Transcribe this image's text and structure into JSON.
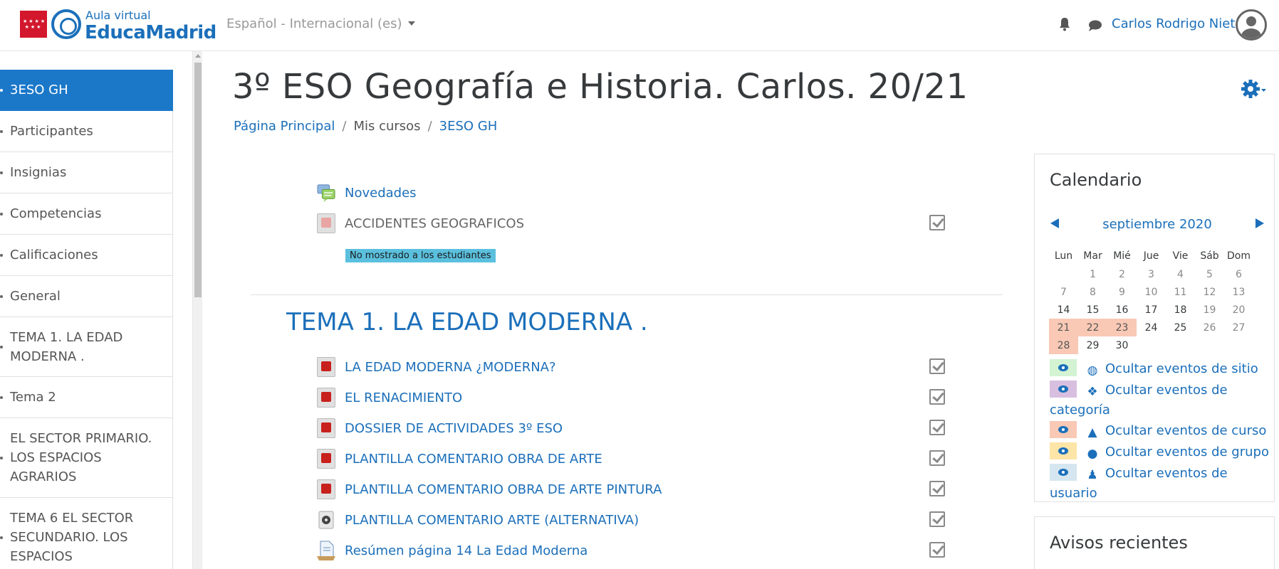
{
  "header": {
    "logo_small": "Aula virtual",
    "logo_big": "EducaMadrid",
    "language": "Español - Internacional (es)",
    "user_name": "Carlos Rodrigo Nieto"
  },
  "drawer": {
    "items": [
      {
        "label": "3ESO GH",
        "active": true
      },
      {
        "label": "Participantes"
      },
      {
        "label": "Insignias"
      },
      {
        "label": "Competencias"
      },
      {
        "label": "Calificaciones"
      },
      {
        "label": "General"
      },
      {
        "label": "TEMA 1. LA EDAD MODERNA ."
      },
      {
        "label": "Tema 2"
      },
      {
        "label": "EL SECTOR PRIMARIO. LOS ESPACIOS AGRARIOS"
      },
      {
        "label": "TEMA 6 EL SECTOR SECUNDARIO. LOS ESPACIOS"
      }
    ]
  },
  "main": {
    "title": "3º ESO Geografía e Historia. Carlos. 20/21",
    "breadcrumb": {
      "home": "Página Principal",
      "my_courses": "Mis cursos",
      "course": "3ESO GH"
    },
    "general_activities": [
      {
        "name": "Novedades",
        "icon": "forum-icon"
      },
      {
        "name": "ACCIDENTES GEOGRAFICOS",
        "icon": "pdf-icon",
        "hidden": true
      }
    ],
    "hidden_badge": "No mostrado a los estudiantes",
    "section_title": "TEMA 1. LA EDAD MODERNA .",
    "section_activities": [
      {
        "name": "LA EDAD MODERNA ¿MODERNA?",
        "icon": "pdf-icon"
      },
      {
        "name": "EL RENACIMIENTO",
        "icon": "pdf-icon"
      },
      {
        "name": "DOSSIER DE ACTIVIDADES 3º ESO",
        "icon": "pdf-icon"
      },
      {
        "name": "PLANTILLA COMENTARIO OBRA DE ARTE",
        "icon": "pdf-icon"
      },
      {
        "name": "PLANTILLA COMENTARIO OBRA DE ARTE PINTURA",
        "icon": "pdf-icon"
      },
      {
        "name": "PLANTILLA COMENTARIO ARTE (ALTERNATIVA)",
        "icon": "file-icon"
      },
      {
        "name": "Resúmen página 14 La Edad Moderna",
        "icon": "page-icon"
      }
    ]
  },
  "calendar": {
    "title": "Calendario",
    "month": "septiembre 2020",
    "weekdays": [
      "Lun",
      "Mar",
      "Mié",
      "Jue",
      "Vie",
      "Sáb",
      "Dom"
    ],
    "weeks": [
      [
        "",
        "1",
        "2",
        "3",
        "4",
        "5",
        "6"
      ],
      [
        "7",
        "8",
        "9",
        "10",
        "11",
        "12",
        "13"
      ],
      [
        "14",
        "15",
        "16",
        "17",
        "18",
        "19",
        "20"
      ],
      [
        "21",
        "22",
        "23",
        "24",
        "25",
        "26",
        "27"
      ],
      [
        "28",
        "29",
        "30",
        "",
        "",
        "",
        ""
      ]
    ],
    "highlighted_days": [
      "21",
      "22",
      "23",
      "28"
    ],
    "event_filters": [
      {
        "label": "Ocultar eventos de sitio",
        "color": "#d3f3d3",
        "icon": "globe-icon"
      },
      {
        "label": "Ocultar eventos de categoría",
        "color": "#d8bfdf",
        "icon": "cubes-icon"
      },
      {
        "label": "Ocultar eventos de curso",
        "color": "#f9c9b5",
        "icon": "graduation-cap-icon"
      },
      {
        "label": "Ocultar eventos de grupo",
        "color": "#fde5a8",
        "icon": "users-icon"
      },
      {
        "label": "Ocultar eventos de usuario",
        "color": "#d5e6f0",
        "icon": "user-icon"
      }
    ]
  },
  "recent": {
    "title": "Avisos recientes"
  },
  "colors": {
    "accent": "#1b6fba",
    "active_nav": "#1b78c9",
    "hidden_badge": "#5bc0de",
    "calendar_highlight": "#f9c9b5"
  }
}
